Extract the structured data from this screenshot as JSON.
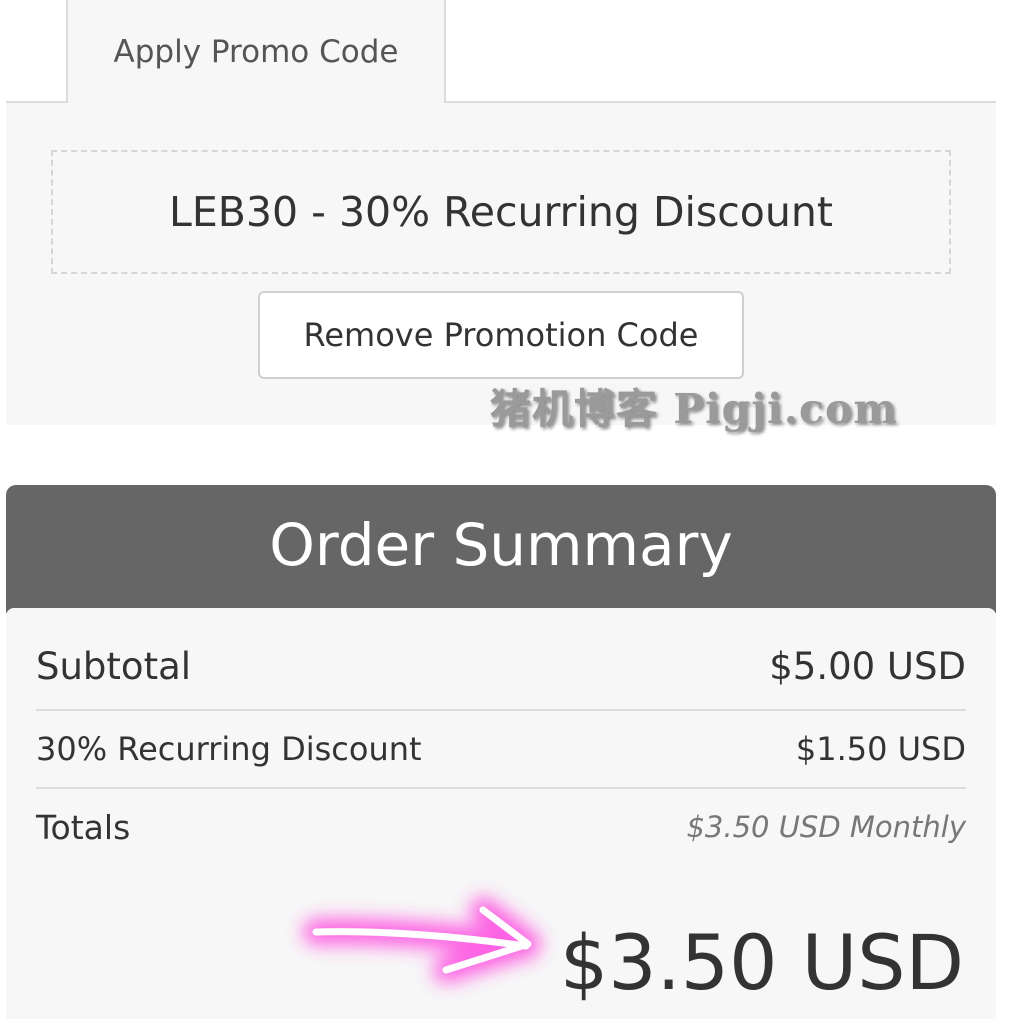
{
  "promo": {
    "tab_label": "Apply Promo Code",
    "applied_code": "LEB30 - 30% Recurring Discount",
    "remove_button_label": "Remove Promotion Code"
  },
  "watermark": "猪机博客 Pigji.com",
  "summary": {
    "title": "Order Summary",
    "rows": [
      {
        "label": "Subtotal",
        "value": "$5.00 USD"
      },
      {
        "label": "30% Recurring Discount",
        "value": "$1.50 USD"
      },
      {
        "label": "Totals",
        "value": "$3.50 USD Monthly"
      }
    ],
    "total_due": "$3.50 USD"
  },
  "colors": {
    "panel_bg": "#f7f7f7",
    "header_bg": "#666666",
    "annotation_arrow": "#ff33dd"
  }
}
